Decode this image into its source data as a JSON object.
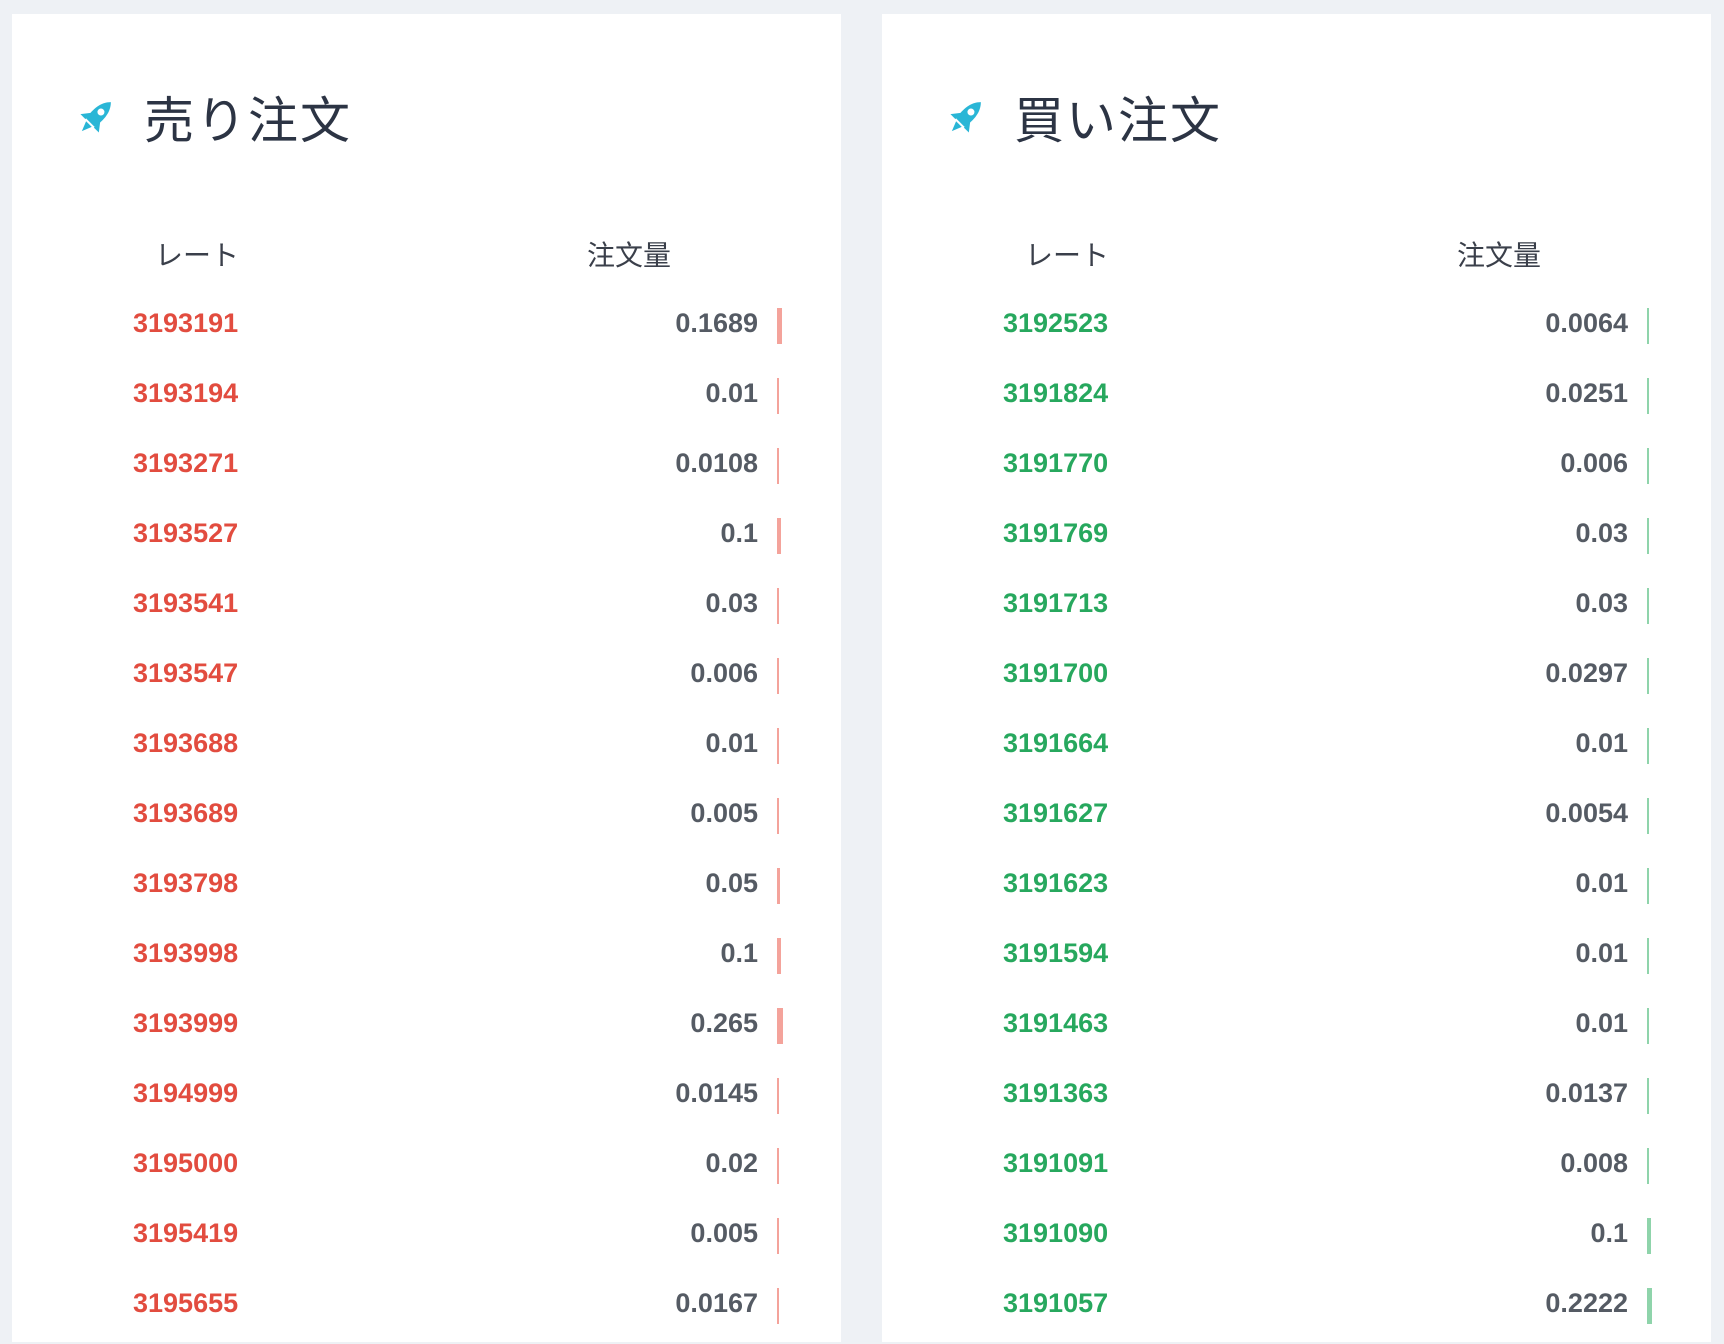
{
  "colors": {
    "page_background": "#eef1f5",
    "panel_background": "#ffffff",
    "icon": "#29b6d6",
    "sell_rate": "#e24c3f",
    "buy_rate": "#27a85e",
    "amount": "#555b64"
  },
  "sell": {
    "title": "売り注文",
    "icon": "rocket-icon",
    "headers": {
      "rate": "レート",
      "amount": "注文量"
    },
    "rows": [
      {
        "rate": "3193191",
        "amount": "0.1689"
      },
      {
        "rate": "3193194",
        "amount": "0.01"
      },
      {
        "rate": "3193271",
        "amount": "0.0108"
      },
      {
        "rate": "3193527",
        "amount": "0.1"
      },
      {
        "rate": "3193541",
        "amount": "0.03"
      },
      {
        "rate": "3193547",
        "amount": "0.006"
      },
      {
        "rate": "3193688",
        "amount": "0.01"
      },
      {
        "rate": "3193689",
        "amount": "0.005"
      },
      {
        "rate": "3193798",
        "amount": "0.05"
      },
      {
        "rate": "3193998",
        "amount": "0.1"
      },
      {
        "rate": "3193999",
        "amount": "0.265"
      },
      {
        "rate": "3194999",
        "amount": "0.0145"
      },
      {
        "rate": "3195000",
        "amount": "0.02"
      },
      {
        "rate": "3195419",
        "amount": "0.005"
      },
      {
        "rate": "3195655",
        "amount": "0.0167"
      }
    ]
  },
  "buy": {
    "title": "買い注文",
    "icon": "rocket-icon",
    "headers": {
      "rate": "レート",
      "amount": "注文量"
    },
    "rows": [
      {
        "rate": "3192523",
        "amount": "0.0064"
      },
      {
        "rate": "3191824",
        "amount": "0.0251"
      },
      {
        "rate": "3191770",
        "amount": "0.006"
      },
      {
        "rate": "3191769",
        "amount": "0.03"
      },
      {
        "rate": "3191713",
        "amount": "0.03"
      },
      {
        "rate": "3191700",
        "amount": "0.0297"
      },
      {
        "rate": "3191664",
        "amount": "0.01"
      },
      {
        "rate": "3191627",
        "amount": "0.0054"
      },
      {
        "rate": "3191623",
        "amount": "0.01"
      },
      {
        "rate": "3191594",
        "amount": "0.01"
      },
      {
        "rate": "3191463",
        "amount": "0.01"
      },
      {
        "rate": "3191363",
        "amount": "0.0137"
      },
      {
        "rate": "3191091",
        "amount": "0.008"
      },
      {
        "rate": "3191090",
        "amount": "0.1"
      },
      {
        "rate": "3191057",
        "amount": "0.2222"
      }
    ]
  }
}
